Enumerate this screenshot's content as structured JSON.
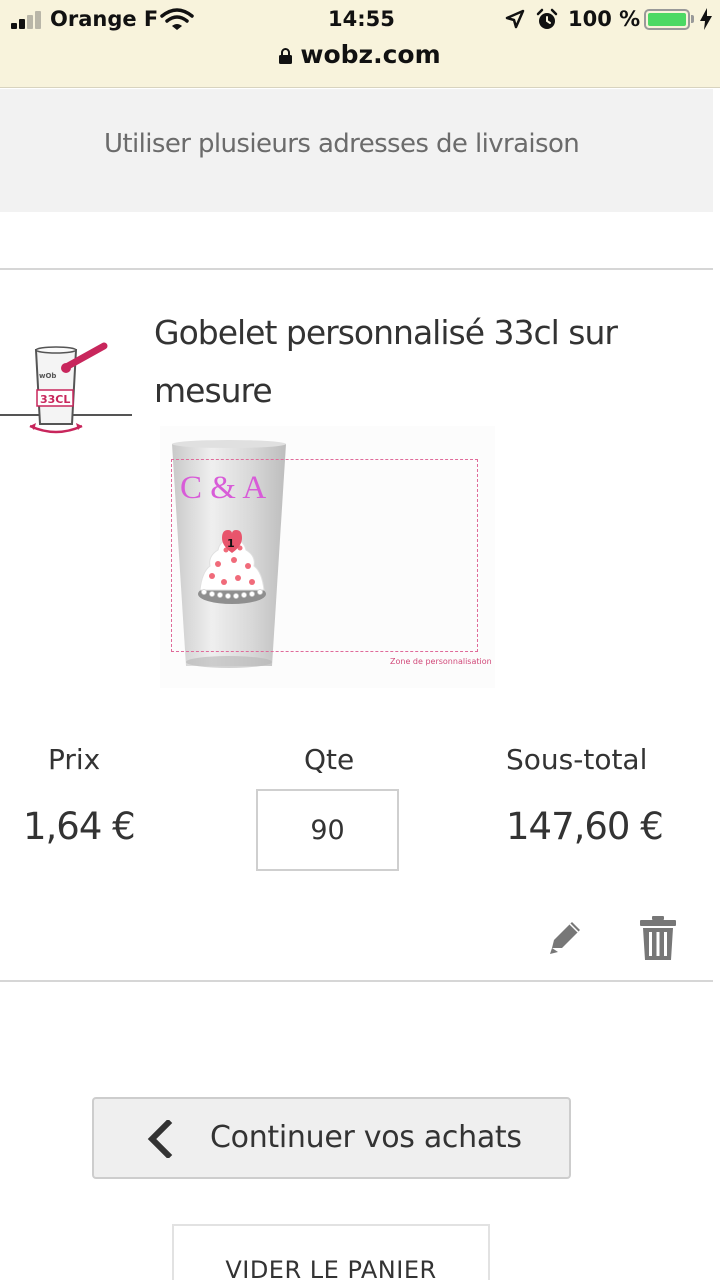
{
  "status_bar": {
    "carrier": "Orange F",
    "time": "14:55",
    "battery": "100 %",
    "battery_color": "#4cd964"
  },
  "browser": {
    "url": "wobz.com"
  },
  "cart": {
    "shipping_link": "Utiliser plusieurs adresses de livraison",
    "item": {
      "name": "Gobelet personnalisé 33cl sur mesure",
      "thumb_label": "33CL",
      "preview": {
        "initials": "C & A",
        "zone_label": "Zone de personnalisation"
      },
      "price_label": "Prix",
      "qty_label": "Qte",
      "subtotal_label": "Sous-total",
      "price": "1,64 €",
      "qty": "90",
      "subtotal": "147,60 €",
      "edit_icon": "pencil-icon",
      "delete_icon": "trash-icon"
    },
    "continue_label": "Continuer vos achats",
    "empty_label": "VIDER LE PANIER"
  },
  "colors": {
    "accent_pink": "#d4245c",
    "primary_text": "#333333"
  }
}
